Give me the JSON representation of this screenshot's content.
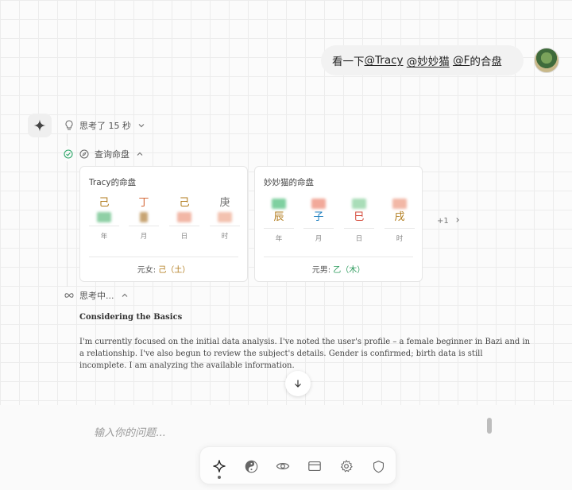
{
  "user_message": {
    "prefix": "看一下",
    "mentions": [
      "@Tracy",
      "@妙妙猫",
      "@F"
    ],
    "suffix": " 的合盘"
  },
  "assistant": {
    "thought_label": "思考了 15 秒",
    "query_label": "查询命盘",
    "thinking_label": "思考中...",
    "thinking_title": "Considering the Basics",
    "thinking_body": "I'm currently focused on the initial data analysis. I've noted the user's profile – a female beginner in Bazi and in a relationship. I've also begun to review the subject's details. Gender is confirmed; birth data is still incomplete. I am analyzing the available information."
  },
  "charts": [
    {
      "title": "Tracy的命盘",
      "pillars": [
        {
          "top": "己",
          "bottom": "",
          "label": "年",
          "top_color": "#b07a1a",
          "blur_color": "#8fd0a6"
        },
        {
          "top": "丁",
          "bottom": "",
          "label": "月",
          "top_color": "#d46a3a",
          "blur_color": "#c8a574"
        },
        {
          "top": "己",
          "bottom": "",
          "label": "日",
          "top_color": "#b07a1a",
          "blur_color": "#f2b7a6"
        },
        {
          "top": "庚",
          "bottom": "",
          "label": "时",
          "top_color": "#777777",
          "blur_color": "#f3c2b0"
        }
      ],
      "footer_prefix": "元女:",
      "footer_value": "己（土）",
      "footer_color": "#b07a1a"
    },
    {
      "title": "妙妙猫的命盘",
      "pillars": [
        {
          "top": "",
          "bottom": "辰",
          "label": "年",
          "bottom_color": "#b07a1a",
          "blur_color": "#7fd0a0"
        },
        {
          "top": "",
          "bottom": "子",
          "label": "月",
          "bottom_color": "#1e7fbf",
          "blur_color": "#f2a99a"
        },
        {
          "top": "",
          "bottom": "巳",
          "label": "日",
          "bottom_color": "#d44a3a",
          "blur_color": "#a9ddb8"
        },
        {
          "top": "",
          "bottom": "戌",
          "label": "时",
          "bottom_color": "#b07a1a",
          "blur_color": "#f2b7a6"
        }
      ],
      "footer_prefix": "元男:",
      "footer_value": "乙（木）",
      "footer_color": "#2a9a5a"
    }
  ],
  "more_label": "+1",
  "composer": {
    "placeholder": "输入你的问题..."
  },
  "toolbar": {
    "items": [
      "sparkle-icon",
      "yin-yang-icon",
      "eye-icon",
      "card-icon",
      "gear-icon",
      "shield-icon"
    ],
    "active": "sparkle-icon"
  }
}
